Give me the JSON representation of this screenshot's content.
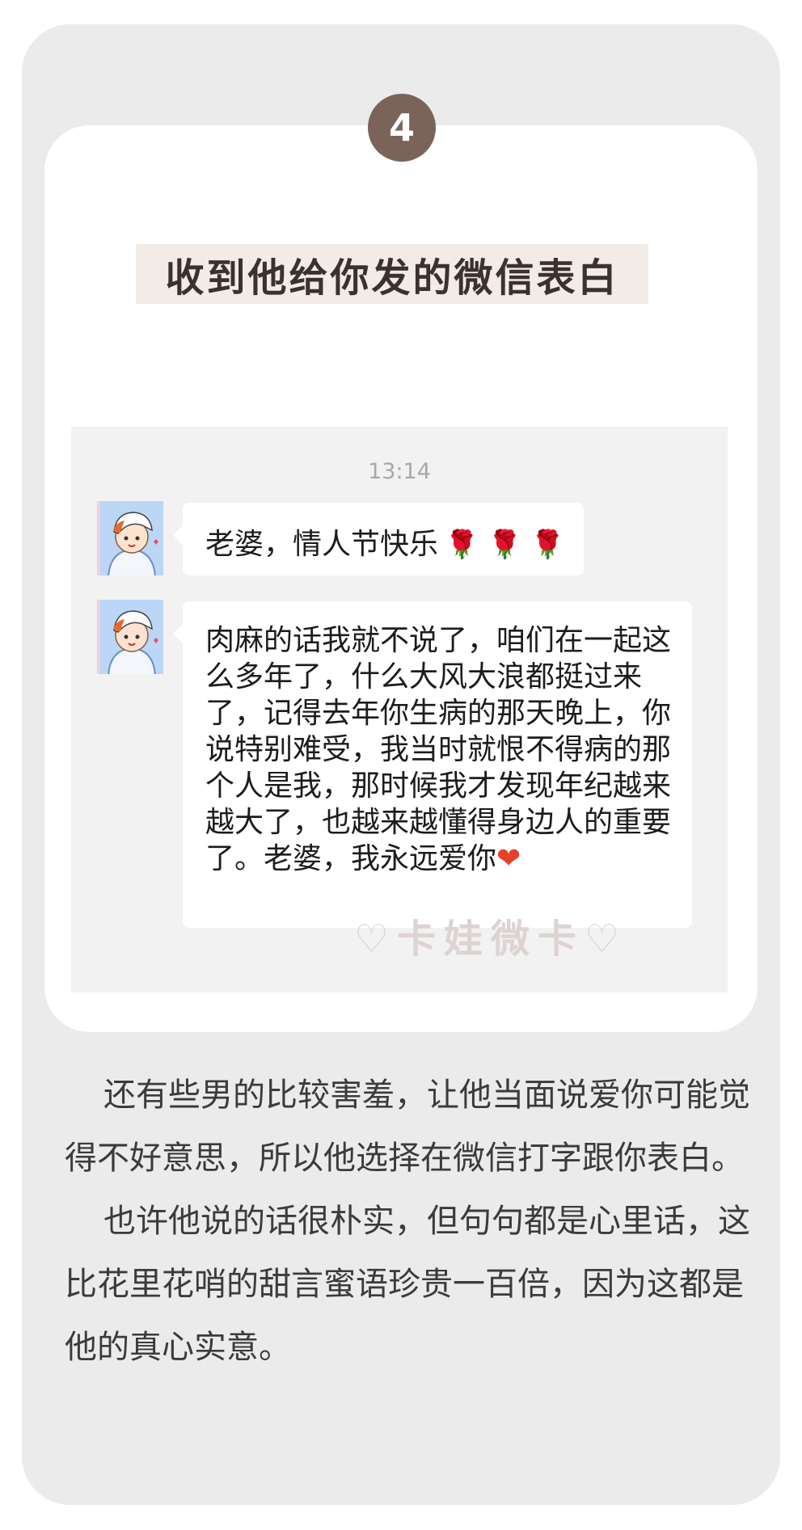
{
  "step": {
    "number": "4"
  },
  "title": "收到他给你发的微信表白",
  "chat": {
    "timestamp": "13:14",
    "messages": [
      {
        "text": "老婆，情人节快乐",
        "emoji": "🌹 🌹 🌹"
      },
      {
        "text": "肉麻的话我就不说了，咱们在一起这么多年了，什么大风大浪都挺过来了，记得去年你生病的那天晚上，你说特别难受，我当时就恨不得病的那个人是我，那时候我才发现年纪越来越大了，也越来越懂得身边人的重要了。老婆，我永远爱你",
        "emoji": "❤"
      }
    ],
    "watermark": "♡卡娃微卡♡"
  },
  "paragraphs": [
    "还有些男的比较害羞，让他当面说爱你可能觉得不好意思，所以他选择在微信打字跟你表白。",
    "也许他说的话很朴实，但句句都是心里话，这比花里花哨的甜言蜜语珍贵一百倍，因为这都是他的真心实意。"
  ],
  "colors": {
    "badge": "#7a6459",
    "title_bg": "#f3ebe5",
    "panel": "#ebebeb"
  },
  "icons": [
    "boy-avatar-icon",
    "rose-emoji-icon",
    "heart-emoji-icon"
  ]
}
